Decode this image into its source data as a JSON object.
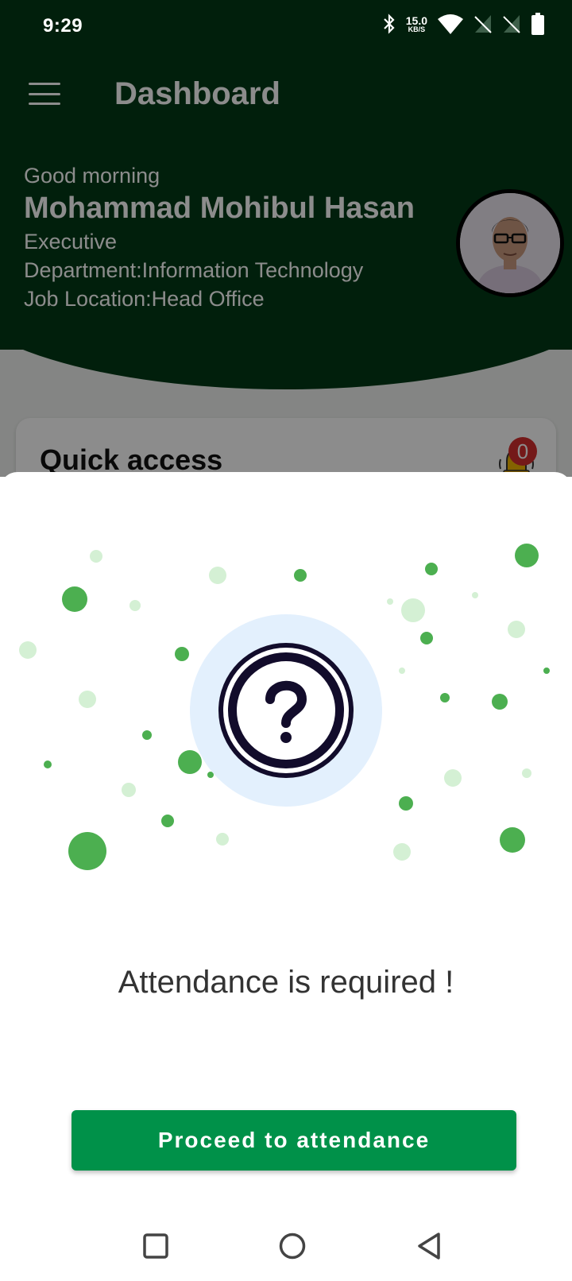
{
  "status_bar": {
    "time": "9:29",
    "net_speed_value": "15.0",
    "net_speed_unit": "KB/S",
    "icons": [
      "bluetooth-icon",
      "wifi-icon",
      "no-sim-icon",
      "no-sim-icon",
      "battery-icon"
    ]
  },
  "app_bar": {
    "title": "Dashboard",
    "menu_icon": "hamburger-menu-icon"
  },
  "profile": {
    "greeting": "Good morning",
    "name": "Mohammad Mohibul Hasan",
    "designation": "Executive",
    "department": "Department:Information Technology",
    "job_location": "Job Location:Head Office"
  },
  "quick_access": {
    "title": "Quick access",
    "notification_count": "0",
    "icon": "bell-icon"
  },
  "dialog": {
    "icon": "question-mark-icon",
    "message": "Attendance is required !",
    "button_label": "Proceed to attendance"
  },
  "nav_bar": {
    "icons": [
      "recent-apps-icon",
      "home-icon",
      "back-icon"
    ]
  },
  "colors": {
    "header_green": "#023a16",
    "button_green": "#009149",
    "dot_green": "#4caf50",
    "dot_light_green": "#d4f0d4",
    "icon_halo": "#e3f0fd",
    "icon_dark": "#120c2b",
    "badge_red": "#d32f2f"
  }
}
